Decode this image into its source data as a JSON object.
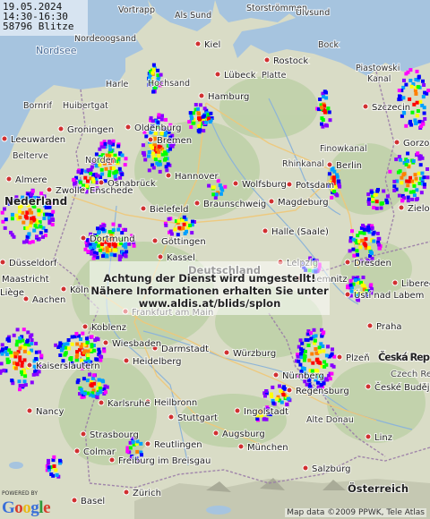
{
  "info_box": {
    "date": "19.05.2024",
    "time_range": "14:30-16:30",
    "count": "58796 Blitze"
  },
  "notice": {
    "line1": "Achtung der Dienst wird umgestellt!",
    "line2": "Nähere Informationen erhalten Sie unter",
    "line3": "www.aldis.at/blids/splon"
  },
  "branding": {
    "powered_by": "POWERED BY",
    "logo": "Google"
  },
  "attribution": "Map data ©2009 PPWK, Tele Atlas",
  "colors": {
    "land": "#d9dcc6",
    "forest": "#b8cfa0",
    "water": "#a6c4df",
    "border": "#9a7ca8",
    "road": "#f3d083",
    "city_dot": "#d03030",
    "lightning_scale": [
      "#ff00ff",
      "#8800ff",
      "#0000ff",
      "#00a0ff",
      "#00ff00",
      "#ffff00",
      "#ff8000",
      "#ff0000"
    ]
  },
  "places": [
    {
      "name": "Vortrapp",
      "size": "minor"
    },
    {
      "name": "Als Sund",
      "size": "minor"
    },
    {
      "name": "Storströmmen",
      "size": "minor"
    },
    {
      "name": "Ulvsund",
      "size": "minor"
    },
    {
      "name": "Nordsee",
      "size": "water"
    },
    {
      "name": "Nordeoogsand",
      "size": "minor"
    },
    {
      "name": "Kiel",
      "size": "major"
    },
    {
      "name": "Bock",
      "size": "minor"
    },
    {
      "name": "Piastowski",
      "size": "minor"
    },
    {
      "name": "Kanal",
      "size": "minor"
    },
    {
      "name": "Lübeck",
      "size": "major"
    },
    {
      "name": "Rostock",
      "size": "major"
    },
    {
      "name": "Harle",
      "size": "minor"
    },
    {
      "name": "Hochsand",
      "size": "minor"
    },
    {
      "name": "Platte",
      "size": "minor"
    },
    {
      "name": "Bornrif",
      "size": "minor"
    },
    {
      "name": "Huibertgat",
      "size": "minor"
    },
    {
      "name": "Hamburg",
      "size": "major"
    },
    {
      "name": "Szczecin",
      "size": "major"
    },
    {
      "name": "Leeuwarden",
      "size": "major"
    },
    {
      "name": "Groningen",
      "size": "major"
    },
    {
      "name": "Oldenburg",
      "size": "major"
    },
    {
      "name": "Bremen",
      "size": "major"
    },
    {
      "name": "Gorzow Wielkopolski",
      "size": "major"
    },
    {
      "name": "Belterve",
      "size": "minor"
    },
    {
      "name": "Norden",
      "size": "minor"
    },
    {
      "name": "Finowkanal",
      "size": "minor"
    },
    {
      "name": "Rhinkanal",
      "size": "minor"
    },
    {
      "name": "Berlin",
      "size": "major"
    },
    {
      "name": "Almere",
      "size": "major"
    },
    {
      "name": "Zwolle",
      "size": "major"
    },
    {
      "name": "Osnabrück",
      "size": "major"
    },
    {
      "name": "Hannover",
      "size": "major"
    },
    {
      "name": "Wolfsburg",
      "size": "major"
    },
    {
      "name": "Potsdam",
      "size": "major"
    },
    {
      "name": "Nederland",
      "size": "country"
    },
    {
      "name": "Enschede",
      "size": "major"
    },
    {
      "name": "Braunschweig",
      "size": "major"
    },
    {
      "name": "Magdeburg",
      "size": "major"
    },
    {
      "name": "Zielona",
      "size": "major"
    },
    {
      "name": "Bielefeld",
      "size": "major"
    },
    {
      "name": "Halle (Saale)",
      "size": "major"
    },
    {
      "name": "Leipzig",
      "size": "major"
    },
    {
      "name": "Göttingen",
      "size": "major"
    },
    {
      "name": "Dortmund",
      "size": "major"
    },
    {
      "name": "Düsseldorf",
      "size": "major"
    },
    {
      "name": "Kassel",
      "size": "major"
    },
    {
      "name": "Deutschland",
      "size": "country"
    },
    {
      "name": "Dresden",
      "size": "major"
    },
    {
      "name": "Maastricht",
      "size": "major"
    },
    {
      "name": "Köln",
      "size": "major"
    },
    {
      "name": "Chemnitz",
      "size": "major"
    },
    {
      "name": "Liberec",
      "size": "major"
    },
    {
      "name": "Liège",
      "size": "major"
    },
    {
      "name": "Aachen",
      "size": "major"
    },
    {
      "name": "Ústí nad Labem",
      "size": "major"
    },
    {
      "name": "Frankfurt am Main",
      "size": "major"
    },
    {
      "name": "Koblenz",
      "size": "major"
    },
    {
      "name": "Praha",
      "size": "major"
    },
    {
      "name": "Wiesbaden",
      "size": "major"
    },
    {
      "name": "Darmstadt",
      "size": "major"
    },
    {
      "name": "Kaiserslautern",
      "size": "major"
    },
    {
      "name": "Würzburg",
      "size": "major"
    },
    {
      "name": "Plzeň",
      "size": "major"
    },
    {
      "name": "Česká Republika",
      "size": "country"
    },
    {
      "name": "Czech Rep.",
      "size": "country"
    },
    {
      "name": "Heidelberg",
      "size": "major"
    },
    {
      "name": "Nürnberg",
      "size": "major"
    },
    {
      "name": "Karlsruhe",
      "size": "major"
    },
    {
      "name": "Regensburg",
      "size": "major"
    },
    {
      "name": "České Budějovice",
      "size": "major"
    },
    {
      "name": "Nancy",
      "size": "major"
    },
    {
      "name": "Heilbronn",
      "size": "major"
    },
    {
      "name": "Stuttgart",
      "size": "major"
    },
    {
      "name": "Ingolstadt",
      "size": "major"
    },
    {
      "name": "Alte Donau",
      "size": "minor"
    },
    {
      "name": "Strasbourg",
      "size": "major"
    },
    {
      "name": "Linz",
      "size": "major"
    },
    {
      "name": "Reutlingen",
      "size": "major"
    },
    {
      "name": "Augsburg",
      "size": "major"
    },
    {
      "name": "München",
      "size": "major"
    },
    {
      "name": "Colmar",
      "size": "major"
    },
    {
      "name": "Freiburg im Breisgau",
      "size": "major"
    },
    {
      "name": "Salzburg",
      "size": "major"
    },
    {
      "name": "Basel",
      "size": "major"
    },
    {
      "name": "Zürich",
      "size": "major"
    },
    {
      "name": "Österreich",
      "size": "country"
    }
  ]
}
